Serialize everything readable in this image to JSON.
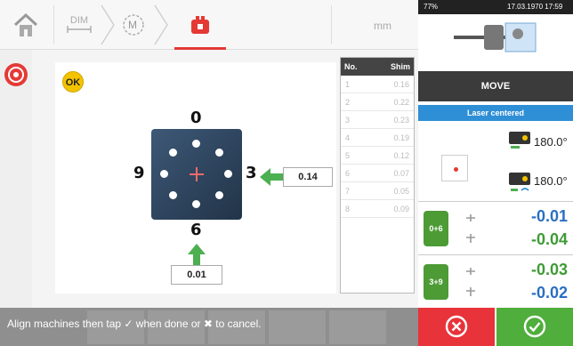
{
  "topbar": {
    "home_label": "Home",
    "dim_label": "DIM",
    "measure_label": "M",
    "unit_label": "mm"
  },
  "main": {
    "ok_badge": "OK",
    "clock": {
      "top": "0",
      "bottom": "6",
      "left": "9",
      "right": "3"
    },
    "right_value": "0.14",
    "bottom_value": "0.01"
  },
  "shim_table": {
    "col_no": "No.",
    "col_shim": "Shim",
    "rows": [
      {
        "no": "1",
        "shim": "0.16"
      },
      {
        "no": "2",
        "shim": "0.22"
      },
      {
        "no": "3",
        "shim": "0.23"
      },
      {
        "no": "4",
        "shim": "0.19"
      },
      {
        "no": "5",
        "shim": "0.12"
      },
      {
        "no": "6",
        "shim": "0.07"
      },
      {
        "no": "7",
        "shim": "0.05"
      },
      {
        "no": "8",
        "shim": "0.09"
      }
    ]
  },
  "message": "Align machines then tap ✓ when done or ✖ to cancel.",
  "right_panel": {
    "status_left": "77%",
    "status_right": "17.03.1970 17:59",
    "move_label": "MOVE",
    "laser_label": "Laser centered",
    "sensor1_angle": "180.0°",
    "sensor2_angle": "180.0°",
    "result1": {
      "label": "0+6",
      "top": "-0.01",
      "bottom": "-0.04"
    },
    "result2": {
      "label": "3+9",
      "top": "-0.03",
      "bottom": "-0.02"
    }
  },
  "colors": {
    "accent_red": "#e53935",
    "accent_green": "#4caf50",
    "laser_blue": "#2f8fd6",
    "cancel_red": "#e8333a",
    "ok_green": "#4fae3c"
  }
}
